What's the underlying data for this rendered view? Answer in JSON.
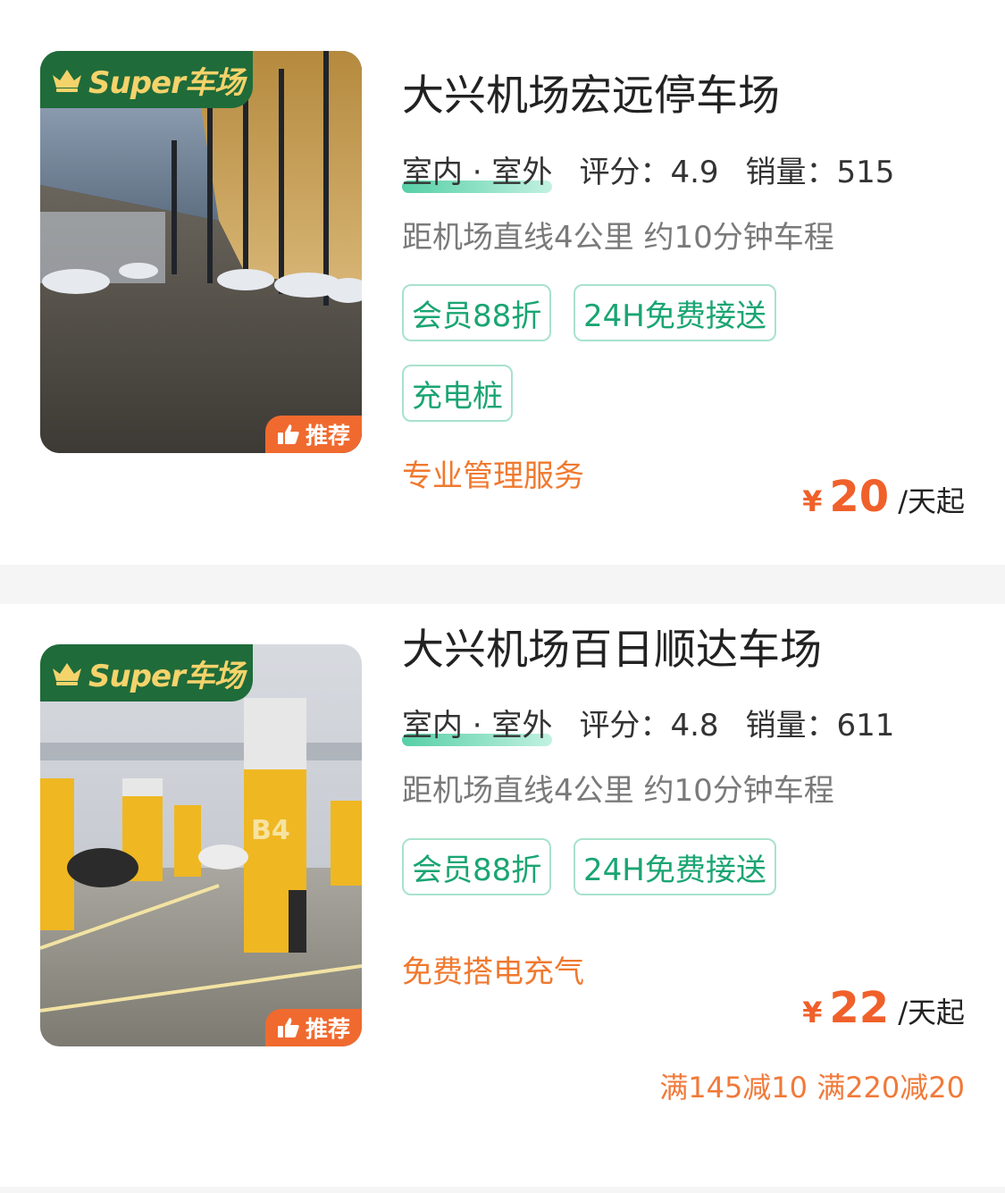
{
  "listings": [
    {
      "super_badge": "Super车场",
      "recommend_badge": "推荐",
      "name": "大兴机场宏远停车场",
      "type": "室内 · 室外",
      "rating_label": "评分：",
      "rating": "4.9",
      "sales_label": "销量：",
      "sales": "515",
      "distance": "距机场直线4公里 约10分钟车程",
      "tags": [
        "会员88折",
        "24H免费接送",
        "充电桩"
      ],
      "promo": "专业管理服务",
      "price_currency": "¥",
      "price": "20",
      "price_unit": "/天起"
    },
    {
      "super_badge": "Super车场",
      "recommend_badge": "推荐",
      "name": "大兴机场百日顺达车场",
      "type": "室内 · 室外",
      "rating_label": "评分：",
      "rating": "4.8",
      "sales_label": "销量：",
      "sales": "611",
      "distance": "距机场直线4公里 约10分钟车程",
      "tags": [
        "会员88折",
        "24H免费接送"
      ],
      "promo": "免费搭电充气",
      "price_currency": "¥",
      "price": "22",
      "price_unit": "/天起",
      "discount": "满145减10 满220减20"
    }
  ],
  "icons": {
    "crown": "crown-icon",
    "thumb": "thumbs-up-icon"
  },
  "colors": {
    "brand_green": "#1f6b3a",
    "badge_gold": "#f5d36b",
    "tag_green": "#1aa573",
    "price_orange": "#f0602a",
    "promo_orange": "#f0792f"
  }
}
